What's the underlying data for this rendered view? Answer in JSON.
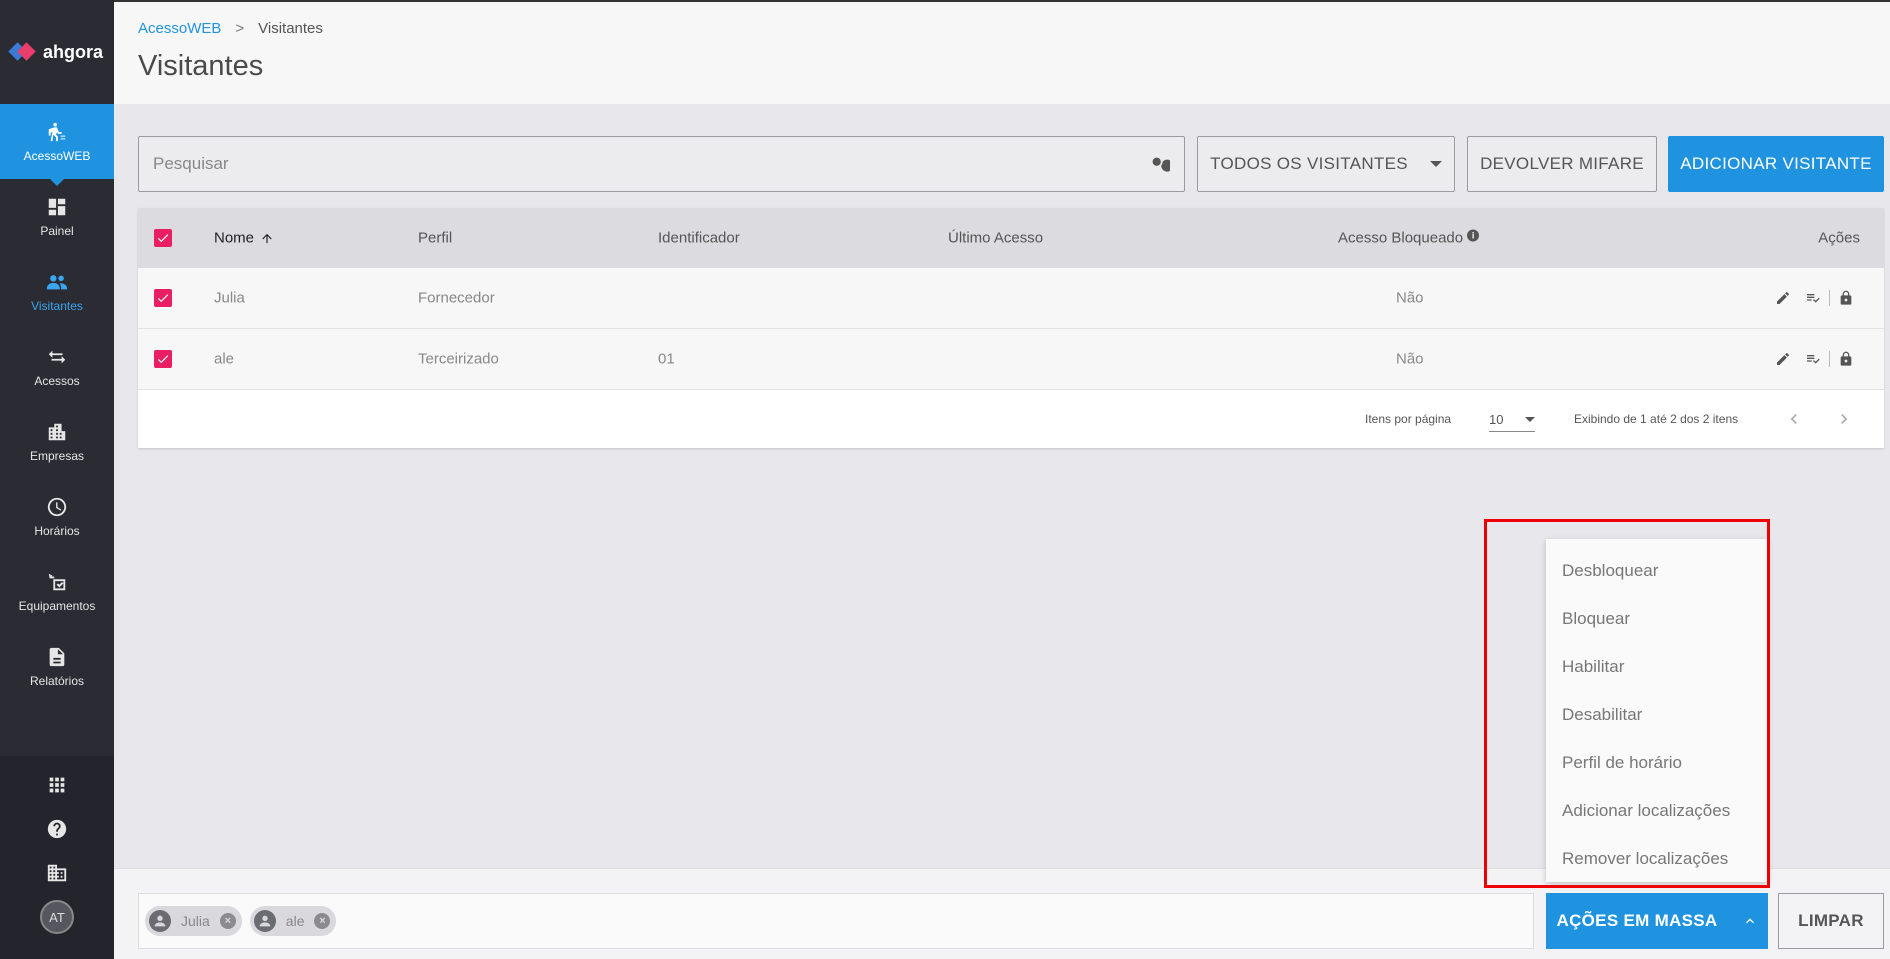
{
  "app": {
    "logo_text": "ahgora"
  },
  "sidebar": {
    "items": [
      {
        "label": "AcessoWEB",
        "icon": "person-walking-icon"
      },
      {
        "label": "Painel",
        "icon": "dashboard-icon"
      },
      {
        "label": "Visitantes",
        "icon": "people-icon"
      },
      {
        "label": "Acessos",
        "icon": "swap-arrows-icon"
      },
      {
        "label": "Empresas",
        "icon": "building-icon"
      },
      {
        "label": "Horários",
        "icon": "clock-icon"
      },
      {
        "label": "Equipamentos",
        "icon": "device-icon"
      },
      {
        "label": "Relatórios",
        "icon": "document-icon"
      }
    ],
    "avatar_initials": "AT"
  },
  "header": {
    "breadcrumb_root": "AcessoWEB",
    "breadcrumb_sep": ">",
    "breadcrumb_current": "Visitantes",
    "title": "Visitantes"
  },
  "toolbar": {
    "search_placeholder": "Pesquisar",
    "filter_label": "TODOS OS VISITANTES",
    "mifare_label": "DEVOLVER MIFARE",
    "add_label": "ADICIONAR VISITANTE"
  },
  "table": {
    "columns": {
      "name": "Nome",
      "profile": "Perfil",
      "identifier": "Identificador",
      "last_access": "Último Acesso",
      "blocked": "Acesso Bloqueado",
      "actions": "Ações"
    },
    "rows": [
      {
        "name": "Julia",
        "profile": "Fornecedor",
        "identifier": "",
        "last_access": "",
        "blocked": "Não"
      },
      {
        "name": "ale",
        "profile": "Terceirizado",
        "identifier": "01",
        "last_access": "",
        "blocked": "Não"
      }
    ],
    "pager": {
      "items_per_page_label": "Itens por página",
      "items_per_page": "10",
      "range_info": "Exibindo de 1 até 2 dos 2 itens"
    }
  },
  "mass_menu": {
    "items": [
      "Desbloquear",
      "Bloquear",
      "Habilitar",
      "Desabilitar",
      "Perfil de horário",
      "Adicionar localizações",
      "Remover localizações"
    ]
  },
  "bottombar": {
    "chips": [
      "Julia",
      "ale"
    ],
    "mass_label": "AÇÕES EM MASSA",
    "clear_label": "LIMPAR"
  },
  "colors": {
    "accent": "#1f93e0",
    "checkbox": "#e91e63",
    "sidebar_bg": "#2a2b33",
    "highlight": "#ee0000"
  }
}
